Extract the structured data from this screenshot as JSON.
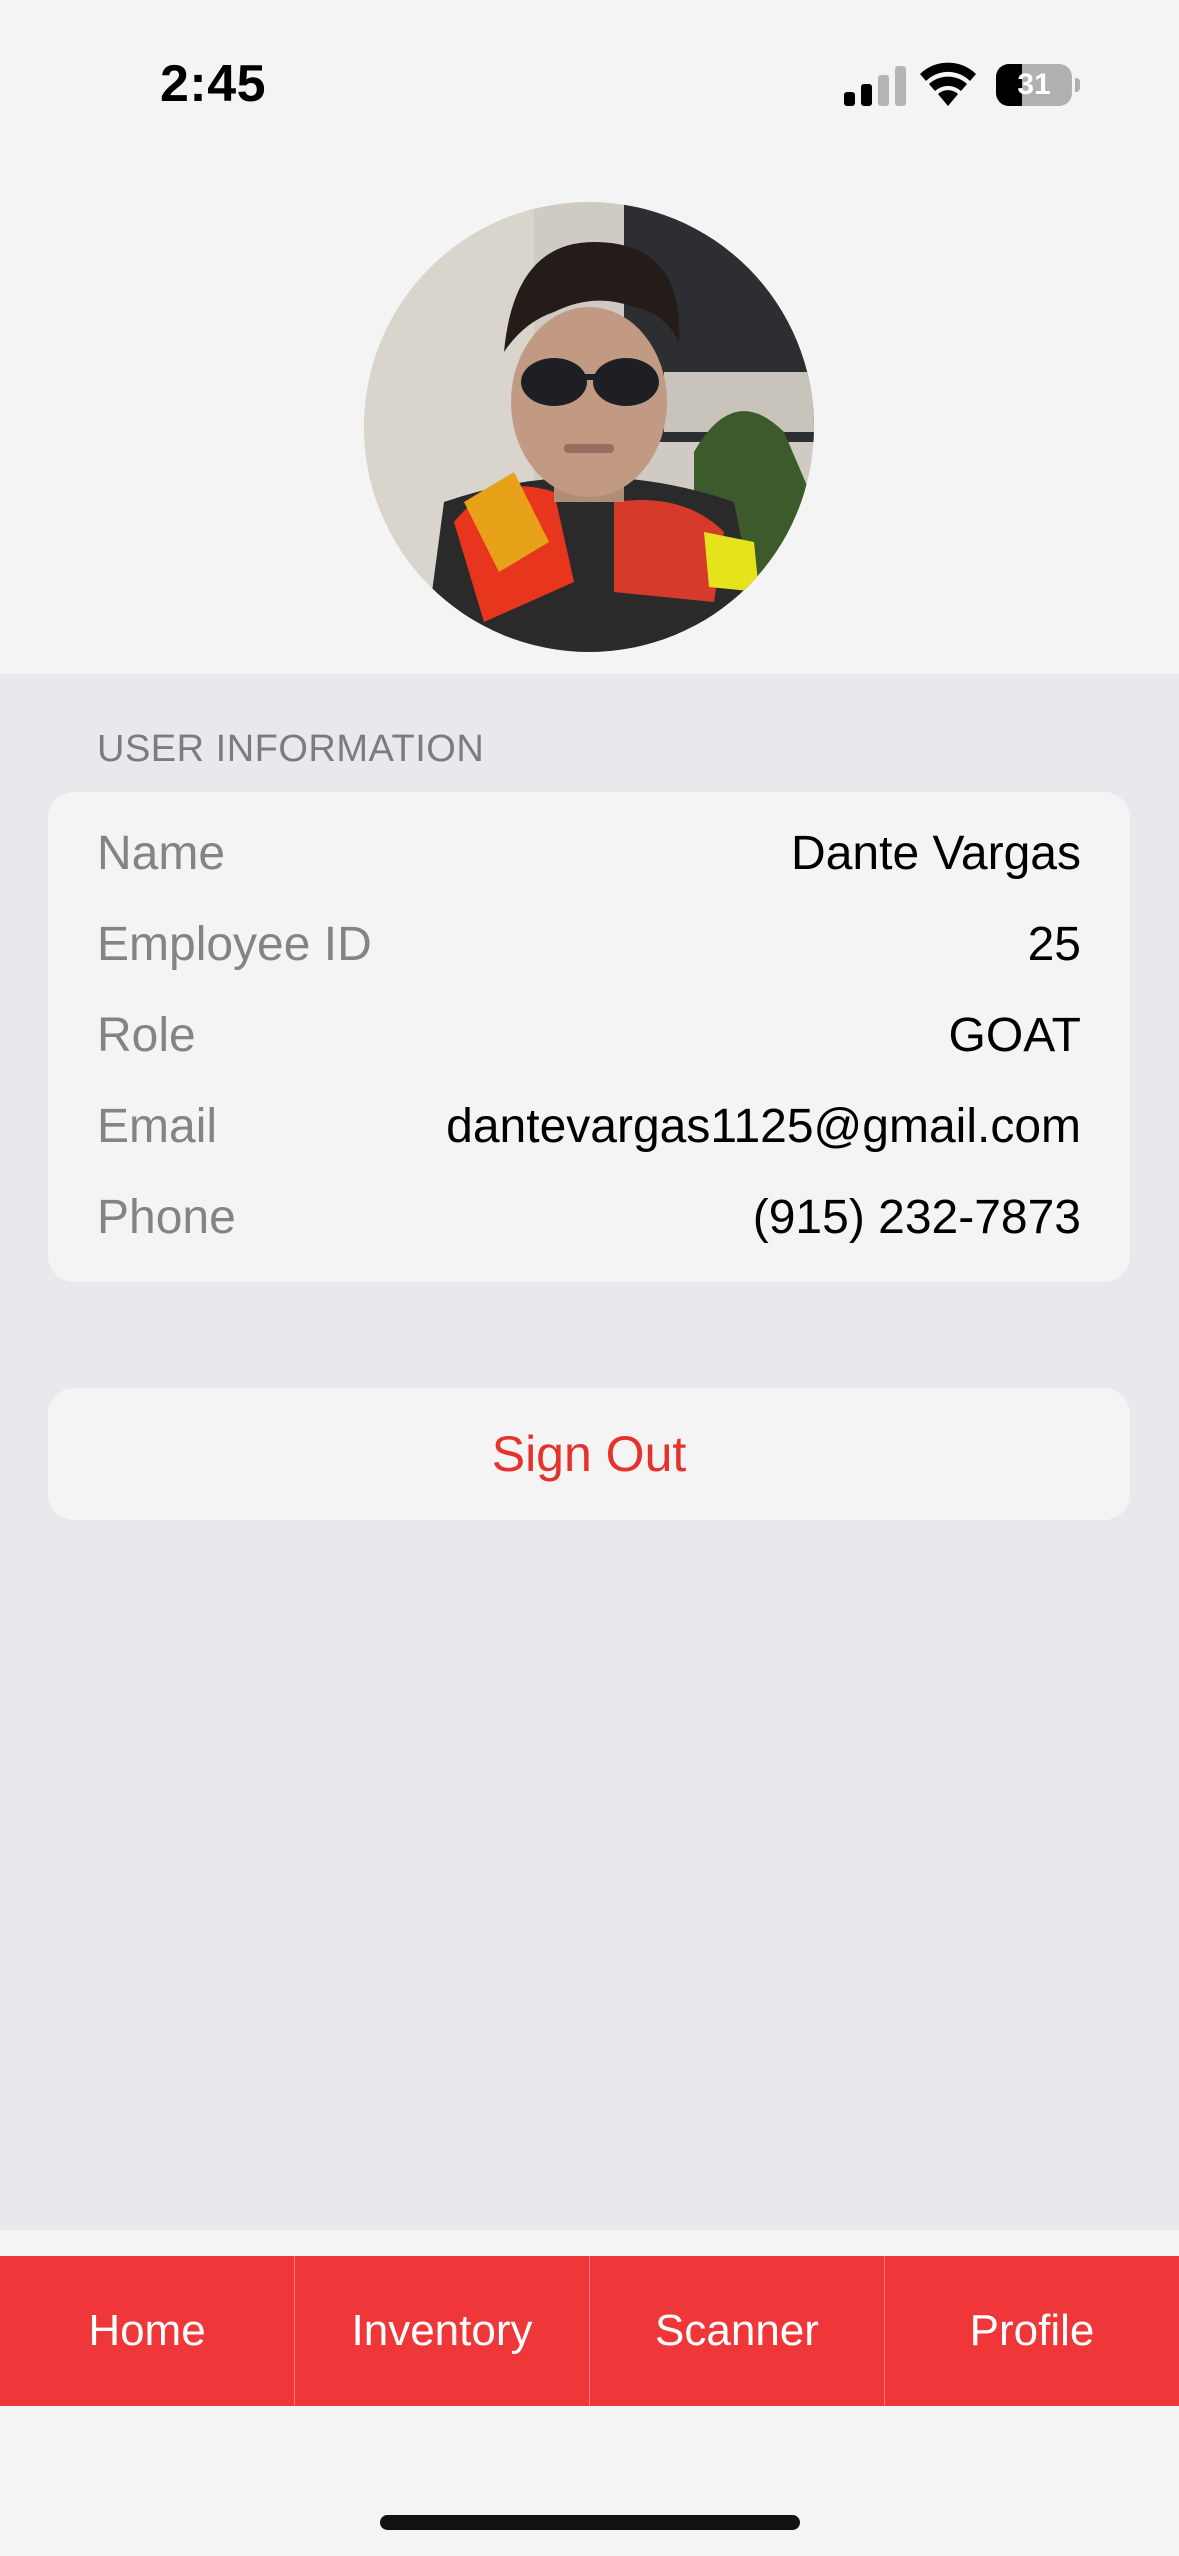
{
  "status_bar": {
    "time": "2:45",
    "battery_level": "31",
    "icons": [
      "signal-icon",
      "wifi-icon",
      "battery-icon"
    ]
  },
  "profile": {
    "avatar": "profile-photo"
  },
  "user_info": {
    "header": "USER INFORMATION",
    "rows": [
      {
        "label": "Name",
        "value": "Dante Vargas"
      },
      {
        "label": "Employee ID",
        "value": "25"
      },
      {
        "label": "Role",
        "value": "GOAT"
      },
      {
        "label": "Email",
        "value": "dantevargas1125@gmail.com"
      },
      {
        "label": "Phone",
        "value": "(915) 232-7873"
      }
    ]
  },
  "actions": {
    "sign_out_label": "Sign Out"
  },
  "tab_bar": {
    "tabs": [
      {
        "label": "Home"
      },
      {
        "label": "Inventory"
      },
      {
        "label": "Scanner"
      },
      {
        "label": "Profile"
      }
    ]
  },
  "colors": {
    "accent": "#ef3639",
    "destructive_text": "#e5322d",
    "page_background": "#f4f4f4",
    "grouped_background": "#e8e9ec",
    "secondary_label": "#838388"
  }
}
